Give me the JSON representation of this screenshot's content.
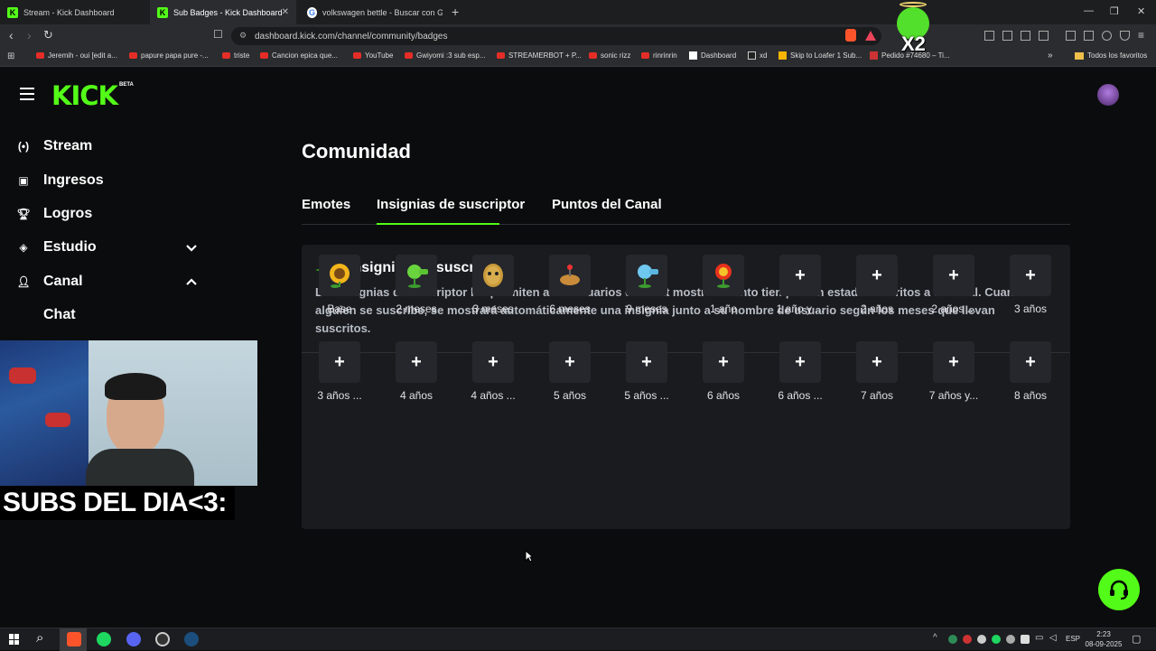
{
  "browser": {
    "tabs": [
      {
        "title": "Stream - Kick Dashboard"
      },
      {
        "title": "Sub Badges - Kick Dashboard"
      },
      {
        "title": "volkswagen bettle - Buscar con Goog"
      }
    ],
    "url": "dashboard.kick.com/channel/community/badges",
    "bookmarks": [
      "Jeremih - oui [edit a...",
      "papure papa pure -...",
      "triste",
      "Cancion epica que...",
      "YouTube",
      "Gwiyomi :3 sub esp...",
      "STREAMERBOT + P...",
      "sonic rizz",
      "rinrinrin",
      "Dashboard",
      "xd",
      "Skip to Loafer 1 Sub...",
      "Pedido #74680 – Ti..."
    ],
    "all_bookmarks": "Todos los favoritos",
    "overlay_text": "X2"
  },
  "brand": {
    "logo": "KICK",
    "beta": "BETA",
    "accent": "#53fc18"
  },
  "sidebar": {
    "items": [
      {
        "label": "Stream",
        "icon": "broadcast-icon"
      },
      {
        "label": "Ingresos",
        "icon": "chart-icon"
      },
      {
        "label": "Logros",
        "icon": "trophy-icon"
      },
      {
        "label": "Estudio",
        "icon": "studio-icon"
      },
      {
        "label": "Canal",
        "icon": "users-icon"
      },
      {
        "label": "Chat"
      }
    ]
  },
  "page": {
    "title": "Comunidad",
    "tabs": [
      "Emotes",
      "Insignias de suscriptor",
      "Puntos del Canal"
    ],
    "active_tab": "Insignias de suscriptor"
  },
  "panel": {
    "title": "Insignias de suscriptor",
    "description": "Las insignias de suscriptor les permiten a los usuarios del chat mostrar cuánto tiempo han estado suscritos a tu canal. Cuando alguien se suscribe, se mostrará automáticamente una insignia junto a su nombre de usuario según los meses que llevan suscritos.",
    "badges": [
      {
        "label": "Base",
        "icon": "sunflower-icon",
        "empty": false
      },
      {
        "label": "2 meses",
        "icon": "peashooter-icon",
        "empty": false
      },
      {
        "label": "3 meses",
        "icon": "wallnut-icon",
        "empty": false
      },
      {
        "label": "6 meses",
        "icon": "potato-mine-icon",
        "empty": false
      },
      {
        "label": "9 meses",
        "icon": "snow-pea-icon",
        "empty": false
      },
      {
        "label": "1 año",
        "icon": "fire-flower-icon",
        "empty": false
      },
      {
        "label": "1 año y ...",
        "empty": true
      },
      {
        "label": "2 años",
        "empty": true
      },
      {
        "label": "2 años ...",
        "empty": true
      },
      {
        "label": "3 años",
        "empty": true
      },
      {
        "label": "3 años ...",
        "empty": true
      },
      {
        "label": "4 años",
        "empty": true
      },
      {
        "label": "4 años ...",
        "empty": true
      },
      {
        "label": "5 años",
        "empty": true
      },
      {
        "label": "5 años ...",
        "empty": true
      },
      {
        "label": "6 años",
        "empty": true
      },
      {
        "label": "6 años ...",
        "empty": true
      },
      {
        "label": "7 años",
        "empty": true
      },
      {
        "label": "7 años y...",
        "empty": true
      },
      {
        "label": "8 años",
        "empty": true
      }
    ],
    "add_symbol": "+"
  },
  "overlay": {
    "subs_text": "SUBS DEL DIA<3:"
  },
  "taskbar": {
    "lang": "ESP",
    "time": "2:23",
    "date": "08-09-2025"
  }
}
